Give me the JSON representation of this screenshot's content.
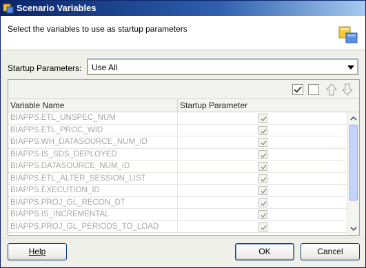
{
  "window": {
    "title": "Scenario Variables"
  },
  "banner": {
    "subtitle": "Select the variables to use as startup parameters"
  },
  "startup": {
    "label": "Startup Parameters:",
    "selected": "Use All"
  },
  "grid": {
    "columns": [
      "Variable Name",
      "Startup Parameter"
    ],
    "rows": [
      {
        "name": "BIAPPS.ETL_UNSPEC_NUM",
        "checked": true
      },
      {
        "name": "BIAPPS.ETL_PROC_WID",
        "checked": true
      },
      {
        "name": "BIAPPS.WH_DATASOURCE_NUM_ID",
        "checked": true
      },
      {
        "name": "BIAPPS.IS_SDS_DEPLOYED",
        "checked": true
      },
      {
        "name": "BIAPPS.DATASOURCE_NUM_ID",
        "checked": true
      },
      {
        "name": "BIAPPS.ETL_ALTER_SESSION_LIST",
        "checked": true
      },
      {
        "name": "BIAPPS.EXECUTION_ID",
        "checked": true
      },
      {
        "name": "BIAPPS.PROJ_GL_RECON_DT",
        "checked": true
      },
      {
        "name": "BIAPPS.IS_INCREMENTAL",
        "checked": true
      },
      {
        "name": "BIAPPS.PROJ_GL_PERIODS_TO_LOAD",
        "checked": true
      }
    ]
  },
  "buttons": {
    "help": "Help",
    "ok": "OK",
    "cancel": "Cancel"
  },
  "colors": {
    "titlebar_start": "#0a246a",
    "disabled_text": "#a8a8a8",
    "select_focus": "#f3b84b"
  },
  "icons": [
    "app-icon",
    "wizard-icon",
    "check-all-icon",
    "uncheck-all-icon",
    "move-up-icon",
    "move-down-icon",
    "dropdown-arrow-icon"
  ]
}
